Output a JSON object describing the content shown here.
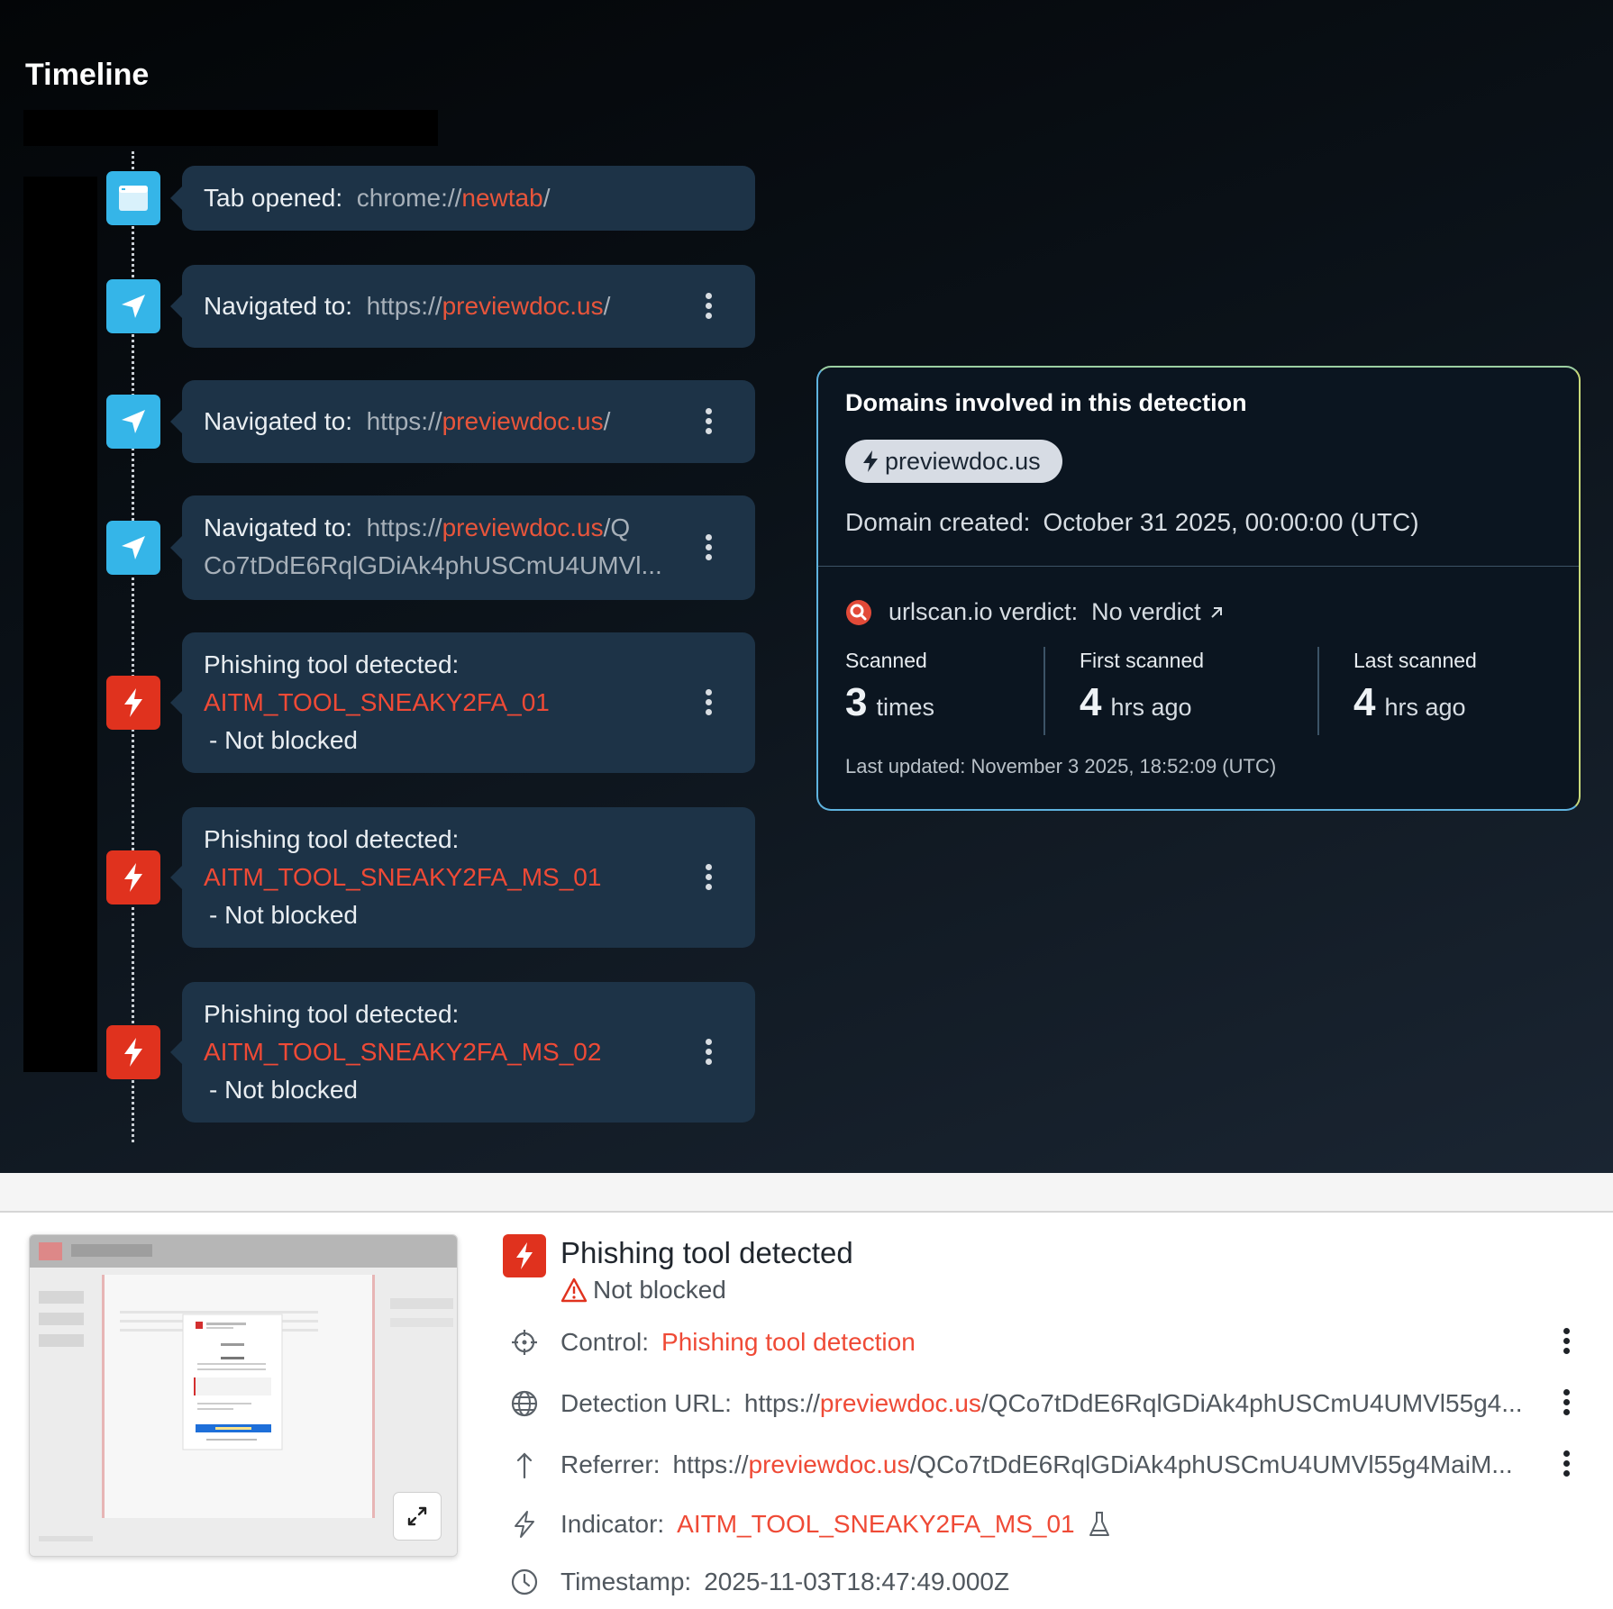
{
  "timeline": {
    "title": "Timeline",
    "events": [
      {
        "label": "Tab opened:",
        "url_prefix": "chrome://",
        "url_domain": "newtab",
        "url_suffix": "/"
      },
      {
        "label": "Navigated to:",
        "url_prefix": "https://",
        "url_domain": "previewdoc.us",
        "url_suffix": "/"
      },
      {
        "label": "Navigated to:",
        "url_prefix": "https://",
        "url_domain": "previewdoc.us",
        "url_suffix": "/"
      },
      {
        "label": "Navigated to:",
        "url_prefix": "https://",
        "url_domain": "previewdoc.us",
        "url_suffix": "/Q",
        "url_line2": "Co7tDdE6RqlGDiAk4phUSCmU4UMVl..."
      },
      {
        "label": "Phishing tool detected:",
        "tool": "AITM_TOOL_SNEAKY2FA_01",
        "status": "-  Not blocked"
      },
      {
        "label": "Phishing tool detected:",
        "tool": "AITM_TOOL_SNEAKY2FA_MS_01",
        "status": "-  Not blocked"
      },
      {
        "label": "Phishing tool detected:",
        "tool": "AITM_TOOL_SNEAKY2FA_MS_02",
        "status": "-  Not blocked"
      }
    ]
  },
  "domains": {
    "title": "Domains involved in this detection",
    "chip": "previewdoc.us",
    "created_label": "Domain created:",
    "created_value": "October 31 2025, 00:00:00 (UTC)",
    "verdict_label": "urlscan.io verdict:",
    "verdict_value": "No verdict",
    "verdict_link_icon": "external-link-arrow",
    "stats": [
      {
        "label": "Scanned",
        "value": "3",
        "unit": "times"
      },
      {
        "label": "First scanned",
        "value": "4",
        "unit": "hrs ago"
      },
      {
        "label": "Last scanned",
        "value": "4",
        "unit": "hrs ago"
      }
    ],
    "updated": "Last updated: November 3 2025, 18:52:09 (UTC)"
  },
  "detail": {
    "title": "Phishing tool detected",
    "status": "Not blocked",
    "rows": {
      "control": {
        "label": "Control:",
        "value": "Phishing tool detection"
      },
      "url": {
        "label": "Detection URL:",
        "prefix": "https://",
        "domain": "previewdoc.us",
        "suffix": "/QCo7tDdE6RqlGDiAk4phUSCmU4UMVl55g4..."
      },
      "referrer": {
        "label": "Referrer:",
        "prefix": "https://",
        "domain": "previewdoc.us",
        "suffix": "/QCo7tDdE6RqlGDiAk4phUSCmU4UMVl55g4MaiM..."
      },
      "indicator": {
        "label": "Indicator:",
        "value": "AITM_TOOL_SNEAKY2FA_MS_01"
      },
      "timestamp": {
        "label": "Timestamp:",
        "value": "2025-11-03T18:47:49.000Z"
      }
    }
  },
  "colors": {
    "accent_red": "#e0321e",
    "node_blue": "#35b5e8",
    "card_bg": "#1d3347"
  }
}
